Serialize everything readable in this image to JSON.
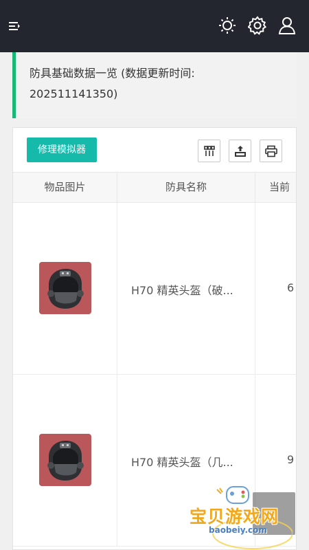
{
  "topbar": {
    "menu_icon": "menu-fold-icon",
    "theme_icon": "sun-icon",
    "settings_icon": "gear-icon",
    "user_icon": "user-icon"
  },
  "notice": {
    "text_line1": "防具基础数据一览 (数据更新时间:",
    "text_line2": "202511141350)",
    "accent_color": "#16b777"
  },
  "toolbar": {
    "repair_label": "修理模拟器",
    "repair_color": "#16baaa",
    "tool_icons": [
      "columns-icon",
      "export-icon",
      "print-icon"
    ]
  },
  "table": {
    "headers": [
      "物品图片",
      "防具名称",
      "当前"
    ],
    "rows": [
      {
        "name": "H70 精英头盔（破...",
        "value": "6"
      },
      {
        "name": "H70 精英头盔（几...",
        "value": "9"
      }
    ]
  },
  "watermark": {
    "title": "宝贝游戏网",
    "url": "baobeiy.com"
  }
}
